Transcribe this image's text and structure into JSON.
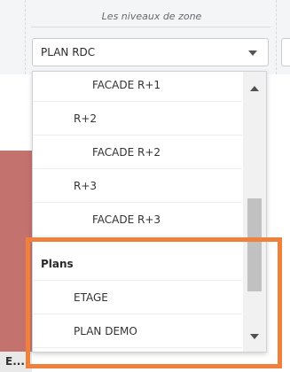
{
  "zone": {
    "label": "Les niveaux de zone",
    "selected_value": "PLAN RDC"
  },
  "dropdown": {
    "items": [
      {
        "label": "FACADE R+1",
        "indent": 2,
        "type": "option"
      },
      {
        "label": "R+2",
        "indent": 1,
        "type": "option"
      },
      {
        "label": "FACADE R+2",
        "indent": 2,
        "type": "option"
      },
      {
        "label": "R+3",
        "indent": 1,
        "type": "option"
      },
      {
        "label": "FACADE R+3",
        "indent": 2,
        "type": "option"
      },
      {
        "label": "Plans",
        "indent": 0,
        "type": "group"
      },
      {
        "label": "ETAGE",
        "indent": 1,
        "type": "option"
      },
      {
        "label": "PLAN DEMO",
        "indent": 1,
        "type": "option"
      }
    ]
  },
  "background": {
    "bottom_left_text": "E..."
  },
  "colors": {
    "highlight": "#f0813c",
    "bg_panel": "#c4726e",
    "scroll_thumb": "#c1c1c1"
  },
  "icons": {
    "select_caret": "chevron-down-icon",
    "scroll_up": "triangle-up-icon",
    "scroll_down": "triangle-down-icon"
  }
}
